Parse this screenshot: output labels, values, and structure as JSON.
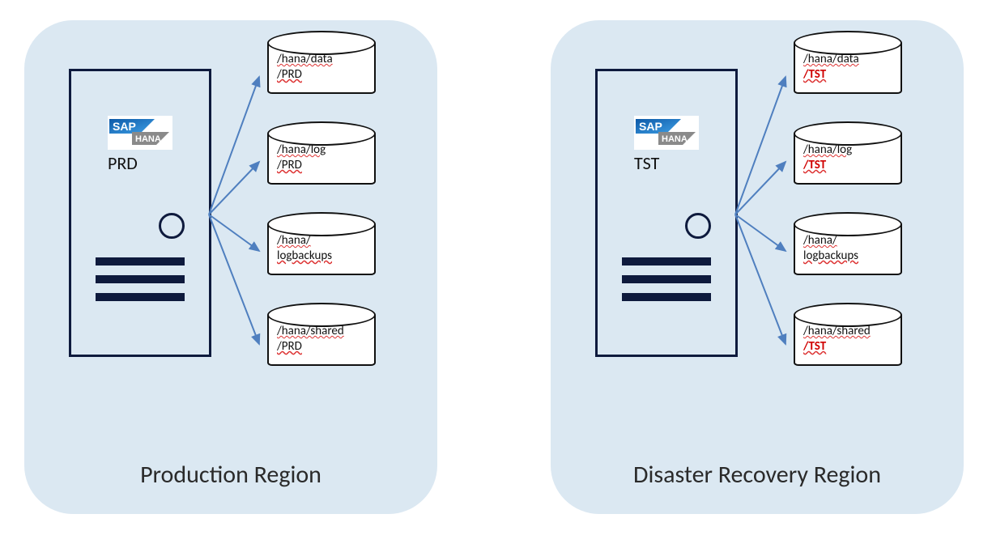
{
  "regions": [
    {
      "key": "prod",
      "title": "Production Region",
      "sid": "PRD",
      "sid_red": false,
      "disks": [
        {
          "line1": "/hana/data",
          "line2": "/PRD",
          "line2_red": false
        },
        {
          "line1": "/hana/log",
          "line2": "/PRD",
          "line2_red": false
        },
        {
          "line1": "/hana/",
          "line2": "logbackups",
          "line2_red": false
        },
        {
          "line1": "/hana/shared",
          "line2": "/PRD",
          "line2_red": false
        }
      ]
    },
    {
      "key": "dr",
      "title": "Disaster Recovery Region",
      "sid": "TST",
      "sid_red": false,
      "disks": [
        {
          "line1": "/hana/data",
          "line2": "/TST",
          "line2_red": true
        },
        {
          "line1": "/hana/log",
          "line2": "/TST",
          "line2_red": true
        },
        {
          "line1": "/hana/",
          "line2": "logbackups",
          "line2_red": false
        },
        {
          "line1": "/hana/shared",
          "line2": "/TST",
          "line2_red": true
        }
      ]
    }
  ],
  "logo": {
    "sap": "SAP",
    "hana": "HANA"
  }
}
